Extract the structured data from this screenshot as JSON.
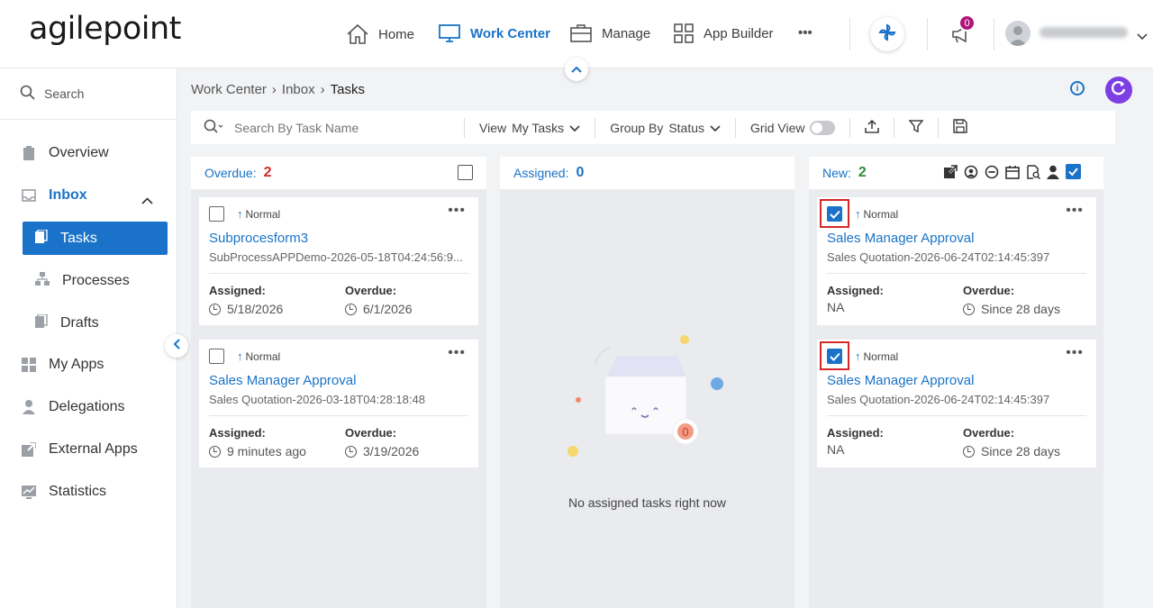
{
  "brand": {
    "logo_text": "agilepoint"
  },
  "nav": {
    "items": [
      {
        "label": "Home",
        "icon": "home-icon"
      },
      {
        "label": "Work Center",
        "icon": "monitor-icon"
      },
      {
        "label": "Manage",
        "icon": "briefcase-icon"
      },
      {
        "label": "App Builder",
        "icon": "grid-icon"
      }
    ],
    "more": "•••",
    "notification_count": "0"
  },
  "sidebar": {
    "search_placeholder": "Search",
    "items": {
      "overview": "Overview",
      "inbox": "Inbox",
      "tasks": "Tasks",
      "processes": "Processes",
      "drafts": "Drafts",
      "my_apps": "My Apps",
      "delegations": "Delegations",
      "external_apps": "External Apps",
      "statistics": "Statistics"
    }
  },
  "breadcrumb": {
    "a": "Work Center",
    "b": "Inbox",
    "c": "Tasks",
    "sep": "›"
  },
  "toolbar": {
    "search_placeholder": "Search By Task Name",
    "view_label": "View",
    "view_value": "My Tasks",
    "group_label": "Group By",
    "group_value": "Status",
    "grid_view_label": "Grid View"
  },
  "columns": {
    "overdue": {
      "label": "Overdue:",
      "count": "2"
    },
    "assigned": {
      "label": "Assigned:",
      "count": "0",
      "empty_text": "No assigned tasks right now",
      "empty_badge": "0"
    },
    "new": {
      "label": "New:",
      "count": "2"
    }
  },
  "cards": {
    "c1": {
      "priority": "Normal",
      "title": "Subprocesform3",
      "subtitle": "SubProcessAPPDemo-2026-05-18T04:24:56:9...",
      "assigned_label": "Assigned:",
      "assigned": "5/18/2026",
      "overdue_label": "Overdue:",
      "overdue": "6/1/2026"
    },
    "c2": {
      "priority": "Normal",
      "title": "Sales Manager Approval",
      "subtitle": "Sales Quotation-2026-03-18T04:28:18:48",
      "assigned_label": "Assigned:",
      "assigned": "9 minutes ago",
      "overdue_label": "Overdue:",
      "overdue": "3/19/2026"
    },
    "c3": {
      "priority": "Normal",
      "title": "Sales Manager Approval",
      "subtitle": "Sales Quotation-2026-06-24T02:14:45:397",
      "assigned_label": "Assigned:",
      "assigned": "NA",
      "overdue_label": "Overdue:",
      "overdue": "Since 28 days"
    },
    "c4": {
      "priority": "Normal",
      "title": "Sales Manager Approval",
      "subtitle": "Sales Quotation-2026-06-24T02:14:45:397",
      "assigned_label": "Assigned:",
      "assigned": "NA",
      "overdue_label": "Overdue:",
      "overdue": "Since 28 days"
    }
  },
  "colors": {
    "accent": "#1a73c8",
    "overdue": "#d62828",
    "new": "#2e8b3a",
    "refresh": "#7b3fe4",
    "badge": "#b0157a"
  }
}
